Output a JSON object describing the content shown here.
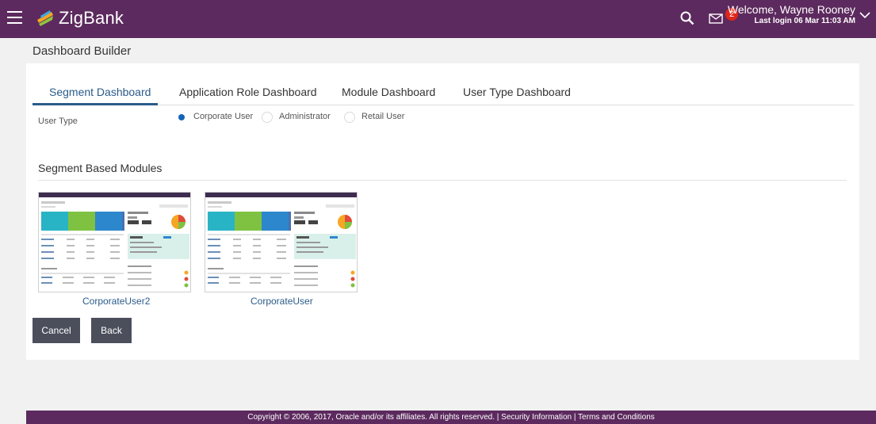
{
  "header": {
    "brand": "ZigBank",
    "notification_count": "2",
    "welcome_text": "Welcome, Wayne Rooney",
    "last_login": "Last login 06 Mar 11:03 AM",
    "icons": [
      "hamburger-menu-icon",
      "zigbank-logo-icon",
      "search-icon",
      "mail-icon",
      "chevron-down-icon"
    ]
  },
  "page": {
    "title": "Dashboard Builder"
  },
  "tabs": [
    {
      "label": "Segment Dashboard",
      "active": true
    },
    {
      "label": "Application Role Dashboard",
      "active": false
    },
    {
      "label": "Module Dashboard",
      "active": false
    },
    {
      "label": "User Type Dashboard",
      "active": false
    }
  ],
  "user_type": {
    "label": "User Type",
    "options": [
      {
        "label": "Corporate User",
        "selected": true
      },
      {
        "label": "Administrator",
        "selected": false
      },
      {
        "label": "Retail User",
        "selected": false
      }
    ]
  },
  "segment_modules": {
    "title": "Segment Based Modules",
    "items": [
      {
        "label": "CorporateUser2"
      },
      {
        "label": "CorporateUser"
      }
    ]
  },
  "buttons": {
    "cancel": "Cancel",
    "back": "Back"
  },
  "footer": {
    "text": "Copyright © 2006, 2017, Oracle and/or its affiliates. All rights reserved. | Security Information | Terms and Conditions"
  },
  "colors": {
    "brand": "#5c2a5e",
    "accent": "#2a5b8a",
    "radio_selected": "#1565b8",
    "badge": "#e0261a",
    "button": "#4b4f5c"
  }
}
